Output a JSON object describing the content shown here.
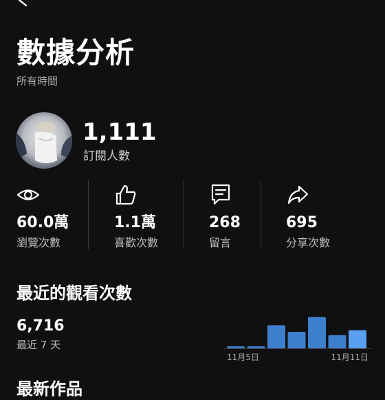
{
  "header": {
    "title": "數據分析",
    "subtitle": "所有時間"
  },
  "channel": {
    "subscriber_count": "1,111",
    "subscriber_label": "訂閱人數"
  },
  "stats": [
    {
      "icon": "eye-icon",
      "value": "60.0萬",
      "label": "瀏覽次數"
    },
    {
      "icon": "thumbs-up-icon",
      "value": "1.1萬",
      "label": "喜歡次數"
    },
    {
      "icon": "comment-icon",
      "value": "268",
      "label": "留言"
    },
    {
      "icon": "share-icon",
      "value": "695",
      "label": "分享次數"
    }
  ],
  "recent": {
    "title": "最近的觀看次數",
    "value": "6,716",
    "label": "最近 7 天"
  },
  "next_section": {
    "title": "最新作品"
  },
  "colors": {
    "background": "#101010",
    "bar": "#3d7fcc",
    "bar_highlight": "#5aa0f0",
    "divider": "#3a3a3a"
  },
  "chart_data": {
    "type": "bar",
    "categories": [
      "11月5日",
      "",
      "",
      "",
      "",
      "",
      "11月11日"
    ],
    "x_tick_labels": [
      "11月5日",
      "11月11日"
    ],
    "values": [
      2,
      2,
      28,
      20,
      38,
      16,
      22
    ],
    "highlighted_index": 6,
    "ylim": [
      0,
      40
    ],
    "grid": false
  }
}
